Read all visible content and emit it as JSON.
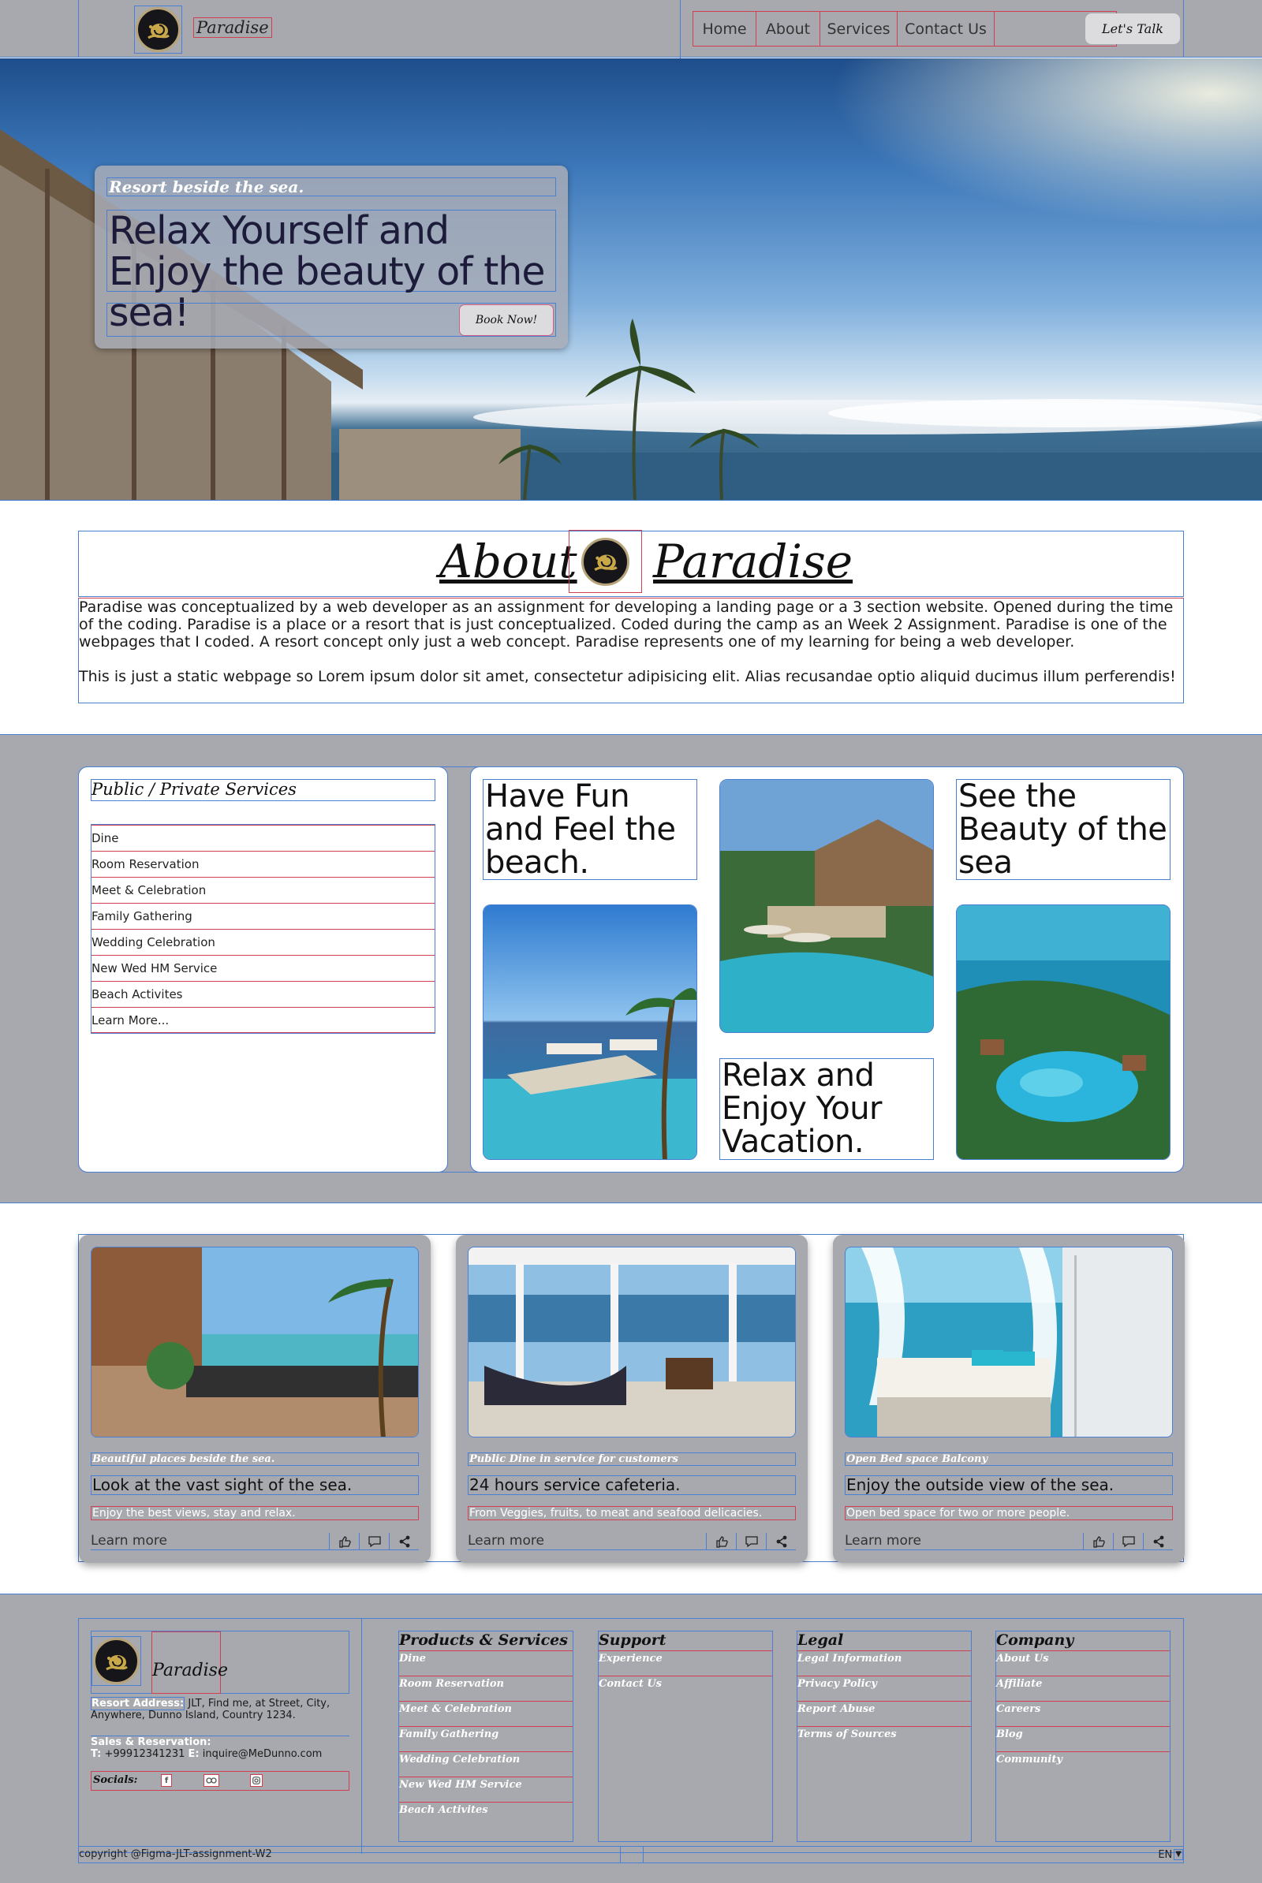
{
  "colors": {
    "band_gray": "#a7a9ae",
    "panel_white": "#ffffff",
    "outline_blue": "#4a7fd1",
    "outline_red": "#d04050",
    "button_light": "#dcdcdf",
    "logo_dark": "#16161a",
    "logo_gold": "#b8a47a"
  },
  "header": {
    "brand": "Paradise",
    "logo_icon": "snail-logo-icon",
    "nav": [
      "Home",
      "About",
      "Services",
      "Contact Us"
    ],
    "cta": "Let's Talk"
  },
  "hero": {
    "eyebrow": "Resort beside the sea.",
    "title": "Relax Yourself and Enjoy the beauty of the sea!",
    "button": "Book Now!"
  },
  "about": {
    "word_left": "About",
    "word_right": "Paradise",
    "paragraph_1": "Paradise was conceptualized by a web developer as an assignment for developing a landing page or a 3 section website. Opened during the time of the coding. Paradise is a place or a resort that is just conceptualized. Coded during the camp as an Week 2 Assignment. Paradise is one of the webpages that I coded. A resort concept only just a web concept. Paradise represents one of my learning for being a web developer.",
    "paragraph_2": "This is just a static webpage so Lorem ipsum dolor sit amet, consectetur adipisicing elit. Alias recusandae optio aliquid ducimus illum perferendis!"
  },
  "services": {
    "title": "Public / Private Services",
    "items": [
      "Dine",
      "Room Reservation",
      "Meet & Celebration",
      "Family Gathering",
      "Wedding Celebration",
      "New Wed HM Service",
      "Beach Activites",
      "Learn More..."
    ]
  },
  "gallery": {
    "heading_1": "Have Fun and Feel the beach.",
    "heading_2": "See the Beauty of the sea",
    "heading_3": "Relax and Enjoy Your Vacation."
  },
  "cards": [
    {
      "eyebrow": "Beautiful places beside the sea.",
      "title": "Look at the vast sight of the sea.",
      "desc": "Enjoy the best views, stay and relax.",
      "link": "Learn more"
    },
    {
      "eyebrow": "Public Dine in service for customers",
      "title": "24 hours service cafeteria.",
      "desc": "From Veggies, fruits, to meat and seafood delicacies.",
      "link": "Learn more"
    },
    {
      "eyebrow": "Open Bed space Balcony",
      "title": "Enjoy the outside view of the sea.",
      "desc": "Open bed space for two or more people.",
      "link": "Learn more"
    }
  ],
  "card_icons": [
    "thumbs-up-icon",
    "comment-icon",
    "share-icon"
  ],
  "footer": {
    "brand": "Paradise",
    "address_label": "Resort Address:",
    "address_text": "JLT, Find me, at Street, City,",
    "address_text_2": "Anywhere, Dunno Island, Country 1234.",
    "sales_label": "Sales & Reservation:",
    "tel_label": "T:",
    "tel_value": "+99912341231",
    "email_label": "E:",
    "email_value": "inquire@MeDunno.com",
    "socials_label": "Socials:",
    "social_icons": [
      "facebook-icon",
      "tripadvisor-icon",
      "instagram-icon"
    ],
    "columns": [
      {
        "title": "Products & Services",
        "links": [
          "Dine",
          "Room Reservation",
          "Meet & Celebration",
          "Family Gathering",
          "Wedding Celebration",
          "New Wed HM Service",
          "Beach Activites"
        ]
      },
      {
        "title": "Support",
        "links": [
          "Experience",
          "Contact Us"
        ]
      },
      {
        "title": "Legal",
        "links": [
          "Legal Information",
          "Privacy Policy",
          "Report Abuse",
          "Terms of Sources"
        ]
      },
      {
        "title": "Company",
        "links": [
          "About Us",
          "Affiliate",
          "Careers",
          "Blog",
          "Community"
        ]
      }
    ],
    "copyright": "copyright @Figma-JLT-assignment-W2",
    "language": "EN"
  }
}
